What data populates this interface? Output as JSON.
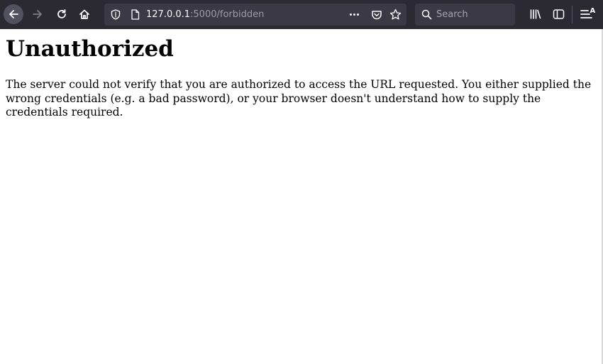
{
  "browser": {
    "url_host": "127.0.0.1",
    "url_rest": ":5000/forbidden",
    "search_placeholder": "Search",
    "menu_badge": "A"
  },
  "icons": {
    "back": "arrow-left-icon",
    "forward": "arrow-right-icon",
    "reload": "reload-icon",
    "home": "home-icon",
    "tracking": "shield-icon",
    "page": "page-icon",
    "page_actions": "more-icon",
    "pocket": "pocket-icon",
    "bookmark": "star-icon",
    "search": "search-icon",
    "library": "library-icon",
    "sidebar": "sidebar-icon",
    "menu": "hamburger-menu-icon"
  },
  "colors": {
    "toolbar_bg": "#2b2a33",
    "field_bg": "#3b3a44",
    "toolbar_icon": "#fbfbfe",
    "url_secondary": "#9d9ca4",
    "page_bg": "#ffffff",
    "page_text": "#000000"
  },
  "page": {
    "title": "Unauthorized",
    "message": "The server could not verify that you are authorized to access the URL requested. You either supplied the wrong credentials (e.g. a bad password), or your browser doesn't understand how to supply the credentials required."
  }
}
